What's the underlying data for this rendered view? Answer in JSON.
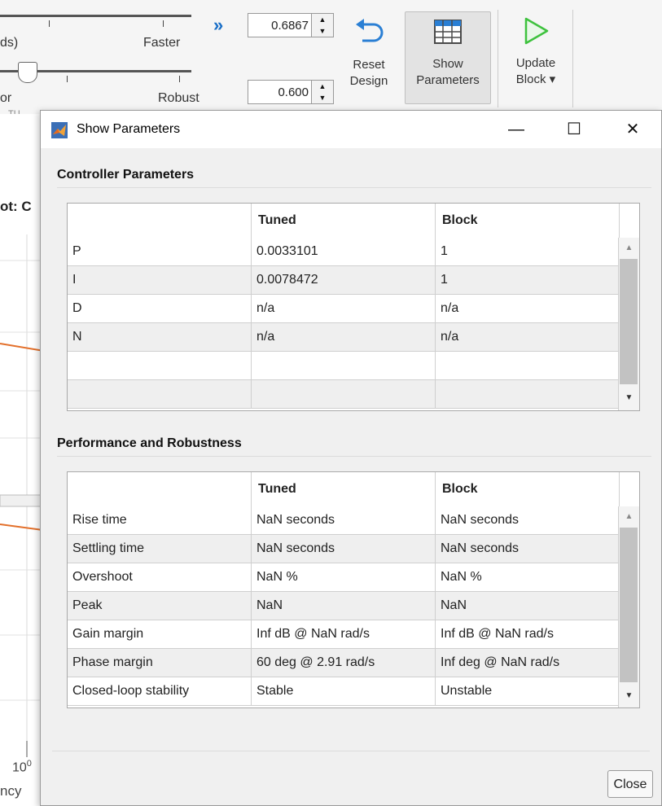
{
  "toolstrip": {
    "slider1_left_label": "ds)",
    "slider1_right_label": "Faster",
    "slider2_left_label": "or",
    "slider2_right_label": "Robust",
    "section_label_fragment": "TU",
    "response_time_value": "0.6867",
    "transient_value": "0.600",
    "reset_design_line1": "Reset",
    "reset_design_line2": "Design",
    "show_parameters_line1": "Show",
    "show_parameters_line2": "Parameters",
    "update_block_line1": "Update",
    "update_block_line2": "Block ▾",
    "more_chevron": "»"
  },
  "background_plot": {
    "title_fragment": "ot: C",
    "x_tick_label": "10",
    "x_tick_exponent": "0",
    "x_axis_fragment": "ncy"
  },
  "dialog": {
    "title": "Show Parameters",
    "minimize_glyph": "—",
    "maximize_glyph": "☐",
    "close_glyph": "✕",
    "close_button": "Close",
    "controller": {
      "section_title": "Controller Parameters",
      "headers": [
        "",
        "Tuned",
        "Block"
      ],
      "rows": [
        [
          "P",
          "0.0033101",
          "1"
        ],
        [
          "I",
          "0.0078472",
          "1"
        ],
        [
          "D",
          "n/a",
          "n/a"
        ],
        [
          "N",
          "n/a",
          "n/a"
        ],
        [
          "",
          "",
          ""
        ],
        [
          "",
          "",
          ""
        ]
      ]
    },
    "performance": {
      "section_title": "Performance and Robustness",
      "headers": [
        "",
        "Tuned",
        "Block"
      ],
      "rows": [
        [
          "Rise time",
          "NaN seconds",
          "NaN seconds"
        ],
        [
          "Settling time",
          "NaN seconds",
          "NaN seconds"
        ],
        [
          "Overshoot",
          "NaN %",
          "NaN %"
        ],
        [
          "Peak",
          "NaN",
          "NaN"
        ],
        [
          "Gain margin",
          "Inf dB @ NaN rad/s",
          "Inf dB @ NaN rad/s"
        ],
        [
          "Phase margin",
          "60 deg @ 2.91 rad/s",
          "Inf deg @ NaN rad/s"
        ],
        [
          "Closed-loop stability",
          "Stable",
          "Unstable"
        ]
      ]
    }
  },
  "colors": {
    "plot_line": "#e3702b",
    "play_icon": "#3ec23e",
    "chevron": "#1a6fc7"
  }
}
